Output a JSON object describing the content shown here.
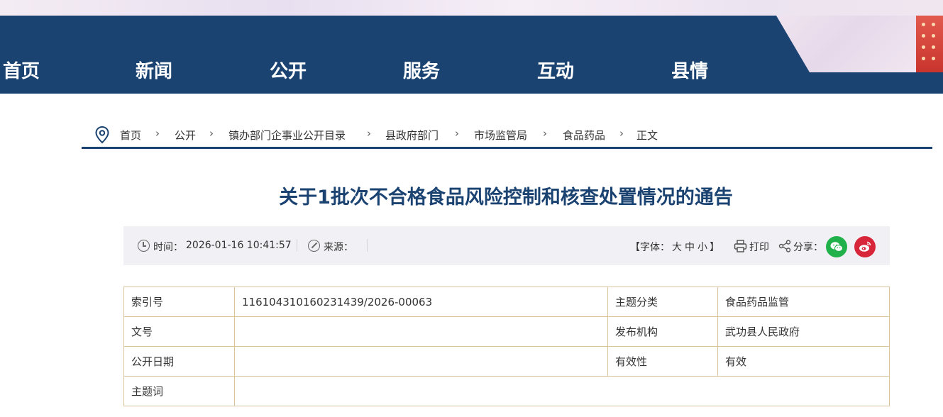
{
  "nav": {
    "items": [
      {
        "label": "首页"
      },
      {
        "label": "新闻"
      },
      {
        "label": "公开"
      },
      {
        "label": "服务"
      },
      {
        "label": "互动"
      },
      {
        "label": "县情"
      }
    ]
  },
  "breadcrumb": {
    "items": [
      "首页",
      "公开",
      "镇办部门企事业公开目录",
      "县政府部门",
      "市场监管局",
      "食品药品",
      "正文"
    ],
    "separator": "›"
  },
  "article": {
    "title": "关于1批次不合格食品风险控制和核查处置情况的通告"
  },
  "meta": {
    "time_label": "时间：",
    "time_value": "2026-01-16 10:41:57",
    "source_label": "来源：",
    "font_open": "【字体：",
    "font_large": "大",
    "font_medium": "中",
    "font_small": "小",
    "font_close": "】",
    "print_label": "打印",
    "share_label": "分享："
  },
  "info": {
    "index_label": "索引号",
    "index_value": "116104310160231439/2026-00063",
    "category_label": "主题分类",
    "category_value": "食品药品监管",
    "doc_no_label": "文号",
    "doc_no_value": "",
    "publisher_label": "发布机构",
    "publisher_value": "武功县人民政府",
    "date_label": "公开日期",
    "date_value": "",
    "validity_label": "有效性",
    "validity_value": "有效",
    "keywords_label": "主题词",
    "keywords_value": ""
  },
  "colors": {
    "nav_bg": "#1b4372",
    "title": "#1b4372",
    "table_border": "#d9c49b",
    "wechat": "#21b14a",
    "weibo": "#d7263a"
  }
}
